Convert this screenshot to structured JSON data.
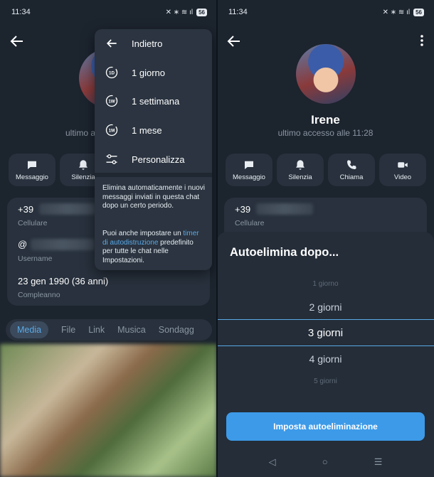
{
  "left": {
    "status": {
      "time": "11:34",
      "icons": "✕ ∗ ≋ ıl",
      "battery": "56"
    },
    "lastseen_partial": "ultimo a",
    "actions": [
      {
        "label": "Messaggio",
        "icon": "message-icon"
      },
      {
        "label": "Silenzia",
        "icon": "bell-icon"
      }
    ],
    "info": {
      "phone_prefix": "+39",
      "phone_label": "Cellulare",
      "username_prefix": "@",
      "username_label": "Username",
      "birthday": "23 gen 1990 (36 anni)",
      "birthday_label": "Compleanno"
    },
    "tabs": [
      "Media",
      "File",
      "Link",
      "Musica",
      "Sondagg"
    ],
    "dropdown": {
      "items": [
        {
          "label": "Indietro",
          "icon": "arrow-left-icon"
        },
        {
          "label": "1 giorno",
          "icon": "timer-1d-icon",
          "badge": "1D"
        },
        {
          "label": "1 settimana",
          "icon": "timer-1w-icon",
          "badge": "1W"
        },
        {
          "label": "1 mese",
          "icon": "timer-1m-icon",
          "badge": "1M"
        },
        {
          "label": "Personalizza",
          "icon": "sliders-icon"
        }
      ],
      "note1": "Elimina automaticamente i nuovi messaggi inviati in questa chat dopo un certo periodo.",
      "note2_pre": "Puoi anche impostare un ",
      "note2_link": "timer di autodistruzione",
      "note2_post": " predefinito per tutte le chat nelle Impostazioni."
    }
  },
  "right": {
    "status": {
      "time": "11:34",
      "icons": "✕ ∗ ≋ ıl",
      "battery": "56"
    },
    "name": "Irene",
    "lastseen": "ultimo accesso alle 11:28",
    "actions": [
      {
        "label": "Messaggio",
        "icon": "message-icon"
      },
      {
        "label": "Silenzia",
        "icon": "bell-icon"
      },
      {
        "label": "Chiama",
        "icon": "phone-icon"
      },
      {
        "label": "Video",
        "icon": "video-icon"
      }
    ],
    "info": {
      "phone_prefix": "+39",
      "phone_label": "Cellulare"
    },
    "sheet": {
      "title": "Autoelimina dopo...",
      "options": [
        "1 giorno",
        "2 giorni",
        "3 giorni",
        "4 giorni",
        "5 giorni"
      ],
      "selected": "3 giorni",
      "button": "Imposta autoeliminazione"
    },
    "navbar": [
      "◁",
      "○",
      "☰"
    ]
  },
  "colors": {
    "background": "#1c242e",
    "card": "#28313d",
    "accent": "#3d9ae8",
    "link": "#5aa9e6",
    "muted": "#8a96a3"
  }
}
